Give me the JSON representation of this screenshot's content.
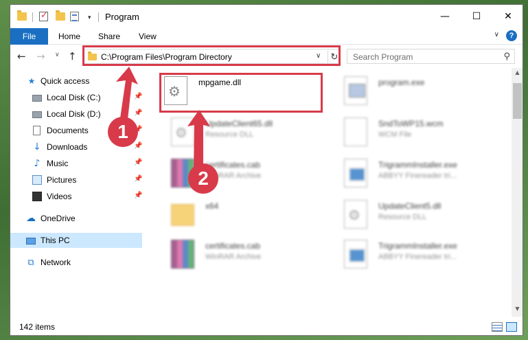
{
  "window": {
    "title": "Program",
    "controls": {
      "minimize": "—",
      "maximize": "☐",
      "close": "✕"
    }
  },
  "ribbon": {
    "tabs": [
      "File",
      "Home",
      "Share",
      "View"
    ],
    "help": "?"
  },
  "address": {
    "path": "C:\\Program Files\\Program Directory"
  },
  "search": {
    "placeholder": "Search Program"
  },
  "navpane": {
    "items": [
      {
        "label": "Quick access",
        "icon": "star-icon",
        "pinned": false
      },
      {
        "label": "Local Disk (C:)",
        "icon": "drive-icon",
        "pinned": true
      },
      {
        "label": "Local Disk (D:)",
        "icon": "drive-icon",
        "pinned": true
      },
      {
        "label": "Documents",
        "icon": "documents-icon",
        "pinned": true
      },
      {
        "label": "Downloads",
        "icon": "download-icon",
        "pinned": true
      },
      {
        "label": "Music",
        "icon": "music-icon",
        "pinned": true
      },
      {
        "label": "Pictures",
        "icon": "pictures-icon",
        "pinned": true
      },
      {
        "label": "Videos",
        "icon": "videos-icon",
        "pinned": true
      },
      {
        "label": "OneDrive",
        "icon": "cloud-icon",
        "pinned": false
      },
      {
        "label": "This PC",
        "icon": "computer-icon",
        "pinned": false,
        "selected": true
      },
      {
        "label": "Network",
        "icon": "network-icon",
        "pinned": false
      }
    ]
  },
  "files": [
    {
      "name": "mpgame.dll",
      "type": "",
      "icon": "dll-gear-icon",
      "highlighted": true
    },
    {
      "name": "program.exe",
      "type": "",
      "icon": "program-exe-icon"
    },
    {
      "name": "UpdateClient65.dll",
      "type": "Resource DLL",
      "icon": "dll-file-icon"
    },
    {
      "name": "SndToWP15.wcm",
      "type": "WCM File",
      "icon": "blank-file-icon"
    },
    {
      "name": "certificates.cab",
      "type": "WinRAR Archive",
      "icon": "winrar-archive-icon"
    },
    {
      "name": "TrigrammInstaller.exe",
      "type": "ABBYY Finereader tri...",
      "icon": "installer-exe-icon"
    },
    {
      "name": "x64",
      "type": "",
      "icon": "folder-icon"
    },
    {
      "name": "UpdateClient5.dll",
      "type": "Resource DLL",
      "icon": "dll-gear-icon"
    },
    {
      "name": "certificates.cab",
      "type": "WinRAR Archive",
      "icon": "winrar-archive-icon"
    },
    {
      "name": "TrigrammInstaller.exe",
      "type": "ABBYY Finereader tri...",
      "icon": "installer-exe-icon"
    }
  ],
  "status": {
    "items_count": "142 items"
  },
  "annotations": {
    "step1": "1",
    "step2": "2",
    "color": "#d83a4a"
  }
}
